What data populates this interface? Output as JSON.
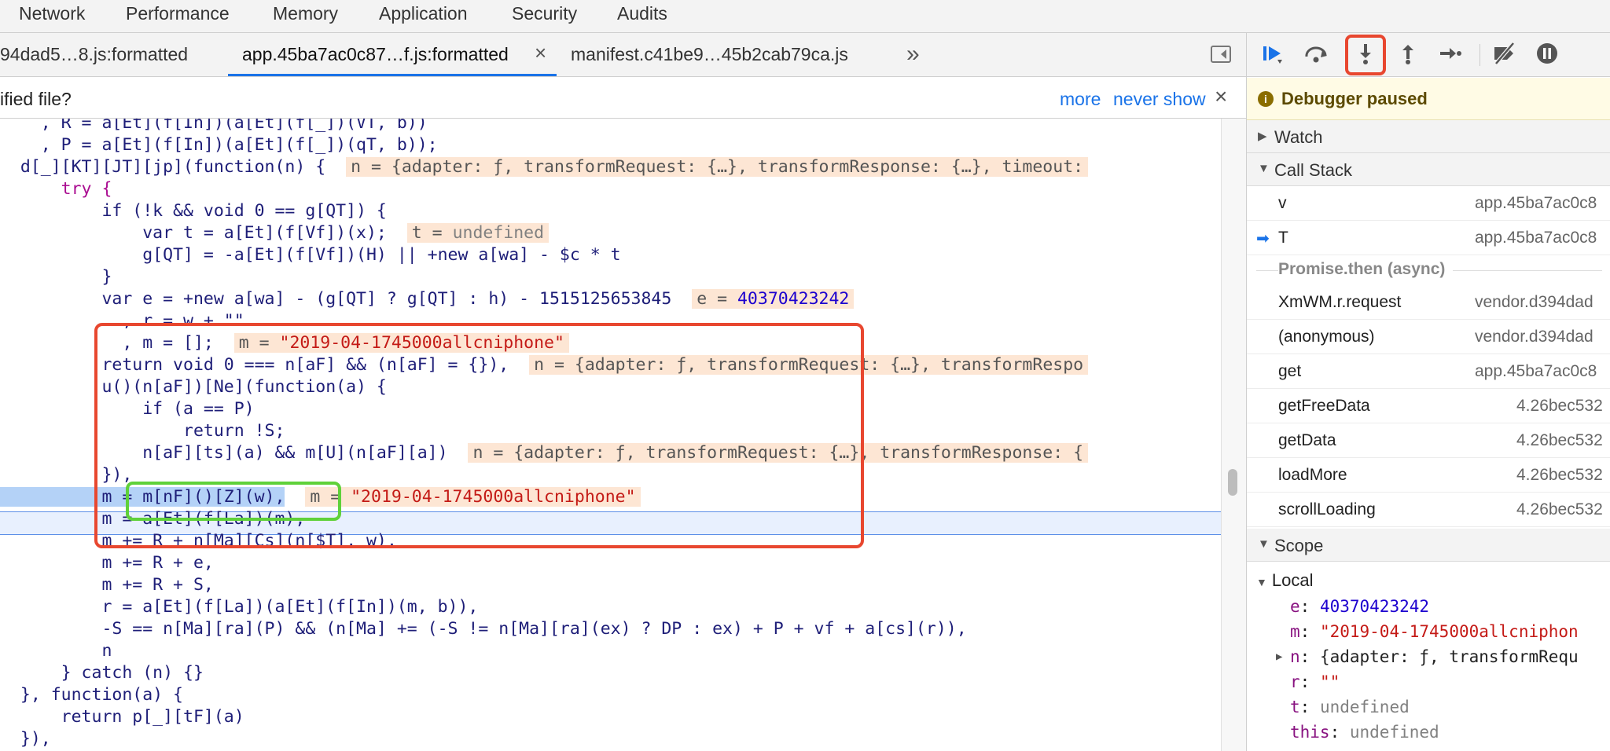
{
  "panel_tabs": [
    "Network",
    "Performance",
    "Memory",
    "Application",
    "Security",
    "Audits"
  ],
  "source_tabs": [
    {
      "label": "94dad5…8.js:formatted",
      "closable": false
    },
    {
      "label": "app.45ba7ac0c87…f.js:formatted",
      "closable": true,
      "active": true
    },
    {
      "label": "manifest.c41be9…45b2cab79ca.js",
      "closable": false
    }
  ],
  "overflow_glyph": "»",
  "infobar": {
    "text": "ified file?",
    "more": "more",
    "never_show": "never show",
    "close": "×"
  },
  "code_lines": [
    "    , R = a[Et](f[In])(a[Et](f[_])(VT, b))",
    "    , P = a[Et](f[In])(a[Et](f[_])(qT, b));",
    "  d[_][KT][JT][jp](function(n) {",
    "      try {",
    "          if (!k && void 0 == g[QT]) {",
    "              var t = a[Et](f[Vf])(x);",
    "              g[QT] = -a[Et](f[Vf])(H) || +new a[wa] - $c * t",
    "          }",
    "          var e = +new a[wa] - (g[QT] ? g[QT] : h) - 1515125653845",
    "            , r = w + \"\"",
    "            , m = [];",
    "          return void 0 === n[aF] && (n[aF] = {}),",
    "          u()(n[aF])[Ne](function(a) {",
    "              if (a == P)",
    "                  return !S;",
    "              n[aF][ts](a) && m[U](n[aF][a])",
    "          }),",
    "          m = m[nF]()[Z](w),",
    "          m = a[Et](f[La])(m),",
    "          m += R + n[Ma][Cs](n[$T], w),",
    "          m += R + e,",
    "          m += R + S,",
    "          r = a[Et](f[La])(a[Et](f[In])(m, b)),",
    "          -S == n[Ma][ra](P) && (n[Ma] += (-S != n[Ma][ra](ex) ? DP : ex) + P + vf + a[cs](r)),",
    "          n",
    "      } catch (n) {}",
    "  }, function(a) {",
    "      return p[_][tF](a)",
    "  }),"
  ],
  "inline_values": {
    "line3": "n = {adapter: ƒ, transformRequest: {…}, transformResponse: {…}, timeout:",
    "line6_key": "t = ",
    "line6_val": "undefined",
    "line9_key": "e = ",
    "line9_val": "40370423242",
    "line11_key": "m = ",
    "line11_val": "\"2019-04-1745000allcniphone\"",
    "line12": "n = {adapter: ƒ, transformRequest: {…}, transformRespo",
    "line16": "n = {adapter: ƒ, transformRequest: {…}, transformResponse: {",
    "line18_key": "m = ",
    "line18_val": "\"2019-04-1745000allcniphone\""
  },
  "debugger": {
    "paused_text": "Debugger paused",
    "sections": {
      "watch": "Watch",
      "call_stack": "Call Stack",
      "scope": "Scope",
      "local": "Local"
    },
    "call_stack": [
      {
        "fn": "v",
        "loc": "app.45ba7ac0c8",
        "current": false
      },
      {
        "fn": "T",
        "loc": "app.45ba7ac0c8",
        "current": true
      },
      {
        "async": "Promise.then (async)"
      },
      {
        "fn": "XmWM.r.request",
        "loc": "vendor.d394dad",
        "current": false
      },
      {
        "fn": "(anonymous)",
        "loc": "vendor.d394dad",
        "current": false
      },
      {
        "fn": "get",
        "loc": "app.45ba7ac0c8",
        "current": false
      },
      {
        "fn": "getFreeData",
        "loc": "4.26bec532",
        "current": false
      },
      {
        "fn": "getData",
        "loc": "4.26bec532",
        "current": false
      },
      {
        "fn": "loadMore",
        "loc": "4.26bec532",
        "current": false
      },
      {
        "fn": "scrollLoading",
        "loc": "4.26bec532",
        "current": false
      }
    ],
    "scope_vars": [
      {
        "name": "e",
        "value": "40370423242",
        "kind": "number"
      },
      {
        "name": "m",
        "value": "\"2019-04-1745000allcniphon",
        "kind": "string"
      },
      {
        "name": "n",
        "value": "{adapter: ƒ, transformRequ",
        "kind": "object"
      },
      {
        "name": "r",
        "value": "\"\"",
        "kind": "string"
      },
      {
        "name": "t",
        "value": "undefined",
        "kind": "undefined"
      },
      {
        "name": "this",
        "value": "undefined",
        "kind": "undefined"
      }
    ]
  },
  "colors": {
    "highlight_red": "#e8472f",
    "highlight_green": "#5fd13a",
    "accent": "#1a73e8"
  }
}
